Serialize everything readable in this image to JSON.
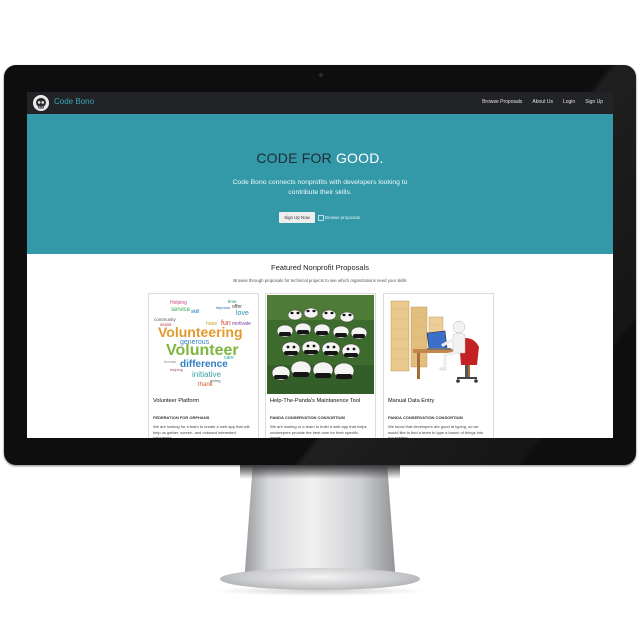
{
  "brand": {
    "name": "Code Bono"
  },
  "nav": {
    "links": [
      "Browse Proposals",
      "About Us",
      "Login",
      "Sign Up"
    ]
  },
  "hero": {
    "title_part1": "CODE FOR",
    "title_part2": "GOOD.",
    "subtitle": "Code Bono connects nonprofits with developers looking to contribute their skills.",
    "signup_label": "Sign Up Now",
    "browse_label": "Browse proposals"
  },
  "featured": {
    "title": "Featured Nonprofit Proposals",
    "subtitle": "Browse through proposals for technical projects to see which organizations need your skills"
  },
  "cards": [
    {
      "title": "Volunteer Platform",
      "org": "FEDERATION FOR ORPHANS",
      "description": "We are looking for a team to create a web app that will help us gather, screen, and onboard interested volunteers.",
      "image_words": [
        "Helping",
        "service",
        "skill",
        "fun",
        "love",
        "motivate",
        "offer",
        "community",
        "Volunteering",
        "Volunteer",
        "generous",
        "difference",
        "initiative",
        "thank",
        "human",
        "helping",
        "time",
        "hope",
        "improve",
        "care",
        "assist",
        "giving"
      ]
    },
    {
      "title": "Help-The-Panda's Maintanence Tool",
      "org": "PANDA CONSERVATION CONSORTIUM",
      "description": "We are looking or a team to build a web app that helps zookeepers provide the best care for their specific needs."
    },
    {
      "title": "Manual Data Entry",
      "org": "PANDA CONSERVATION CONSORTIUM",
      "description": "We know that developers are good at typing, so we would like to find a team to type a bunch of things into our system."
    }
  ],
  "colors": {
    "hero_bg": "#3398a8",
    "navbar_bg": "#222326",
    "brand": "#3ba6b8"
  }
}
